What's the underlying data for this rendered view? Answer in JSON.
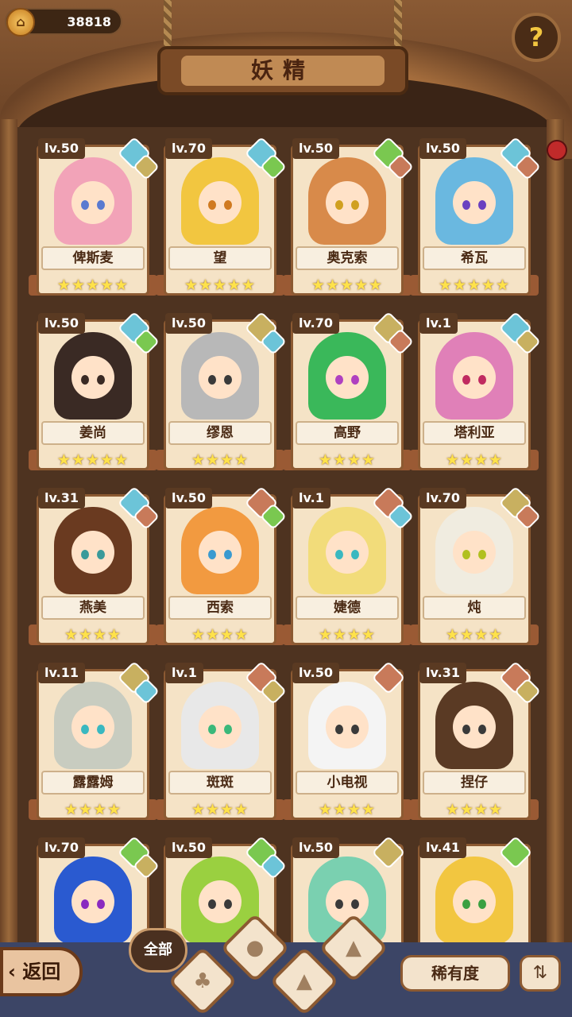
{
  "header": {
    "coins": "38818",
    "title": "妖精",
    "help_icon": "help-question-icon"
  },
  "fairies": [
    {
      "level": "lv.50",
      "name": "俾斯麦",
      "stars": "★★★★★",
      "hair": "#f2a3b8",
      "eye": "#5a7ad0",
      "elements": [
        "water",
        "earth"
      ]
    },
    {
      "level": "lv.70",
      "name": "望",
      "stars": "★★★★★",
      "hair": "#f2c640",
      "eye": "#d07a20",
      "elements": [
        "water",
        "wood"
      ]
    },
    {
      "level": "lv.50",
      "name": "奥克索",
      "stars": "★★★★★",
      "hair": "#d88a4a",
      "eye": "#d0a020",
      "elements": [
        "wood",
        "fire"
      ]
    },
    {
      "level": "lv.50",
      "name": "希瓦",
      "stars": "★★★★★",
      "hair": "#6ab8e0",
      "eye": "#6a40c0",
      "elements": [
        "water",
        "fire"
      ]
    },
    {
      "level": "lv.50",
      "name": "姜尚",
      "stars": "★★★★★",
      "hair": "#3a2a24",
      "eye": "#3a2a24",
      "elements": [
        "water",
        "wood"
      ]
    },
    {
      "level": "lv.50",
      "name": "缪恩",
      "stars": "★★★★",
      "hair": "#b8b8b8",
      "eye": "#3a3a3a",
      "elements": [
        "earth",
        "water"
      ]
    },
    {
      "level": "lv.70",
      "name": "高野",
      "stars": "★★★★",
      "hair": "#3ab85a",
      "eye": "#b040c0",
      "elements": [
        "earth",
        "fire"
      ]
    },
    {
      "level": "lv.1",
      "name": "塔利亚",
      "stars": "★★★★",
      "hair": "#e080b8",
      "eye": "#c02a60",
      "elements": [
        "water",
        "earth"
      ]
    },
    {
      "level": "lv.31",
      "name": "燕美",
      "stars": "★★★★",
      "hair": "#6a3a20",
      "eye": "#3a9a9a",
      "elements": [
        "water",
        "fire"
      ]
    },
    {
      "level": "lv.50",
      "name": "西索",
      "stars": "★★★★",
      "hair": "#f29a40",
      "eye": "#3a9ad0",
      "elements": [
        "fire",
        "wood"
      ]
    },
    {
      "level": "lv.1",
      "name": "婕德",
      "stars": "★★★★",
      "hair": "#f2dc7a",
      "eye": "#3ab8c0",
      "elements": [
        "fire",
        "water"
      ]
    },
    {
      "level": "lv.70",
      "name": "炖",
      "stars": "★★★★",
      "hair": "#f0ece0",
      "eye": "#b0c020",
      "elements": [
        "earth",
        "fire"
      ]
    },
    {
      "level": "lv.11",
      "name": "露露姆",
      "stars": "★★★★",
      "hair": "#c8ccc0",
      "eye": "#3ab8c0",
      "elements": [
        "earth",
        "water"
      ]
    },
    {
      "level": "lv.1",
      "name": "斑斑",
      "stars": "★★★★",
      "hair": "#e8e8e8",
      "eye": "#3ab87a",
      "elements": [
        "fire",
        "earth"
      ]
    },
    {
      "level": "lv.50",
      "name": "小电视",
      "stars": "★★★★",
      "hair": "#f4f4f4",
      "eye": "#3a3a3a",
      "elements": [
        "fire"
      ]
    },
    {
      "level": "lv.31",
      "name": "捏仔",
      "stars": "★★★★",
      "hair": "#5a3a24",
      "eye": "#3a3a3a",
      "elements": [
        "fire",
        "earth"
      ]
    },
    {
      "level": "lv.70",
      "name": "",
      "stars": "",
      "hair": "#2a5ad0",
      "eye": "#8a2ac0",
      "elements": [
        "wood",
        "earth"
      ]
    },
    {
      "level": "lv.50",
      "name": "",
      "stars": "",
      "hair": "#9ad040",
      "eye": "#3a3a3a",
      "elements": [
        "wood",
        "water"
      ]
    },
    {
      "level": "lv.50",
      "name": "",
      "stars": "",
      "hair": "#7ad0b0",
      "eye": "#3a3a3a",
      "elements": [
        "earth"
      ]
    },
    {
      "level": "lv.41",
      "name": "",
      "stars": "",
      "hair": "#f2c640",
      "eye": "#3aa040",
      "elements": [
        "wood"
      ]
    }
  ],
  "element_colors": {
    "water": "#6cc4d8",
    "earth": "#c8b060",
    "wood": "#7ac850",
    "fire": "#c87a5a"
  },
  "bottom": {
    "back_label": "返回",
    "filter_all_label": "全部",
    "sort_label": "稀有度",
    "order_icon": "sort-order-icon"
  }
}
